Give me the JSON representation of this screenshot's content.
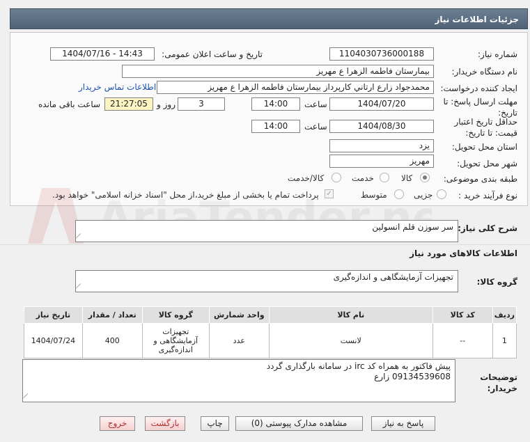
{
  "header": {
    "title": "جزئیات اطلاعات نیاز"
  },
  "fields": {
    "need_number_label": "شماره نیاز:",
    "need_number": "1104030736000188",
    "announce_label": "تاریخ و ساعت اعلان عمومی:",
    "announce_value": "1404/07/16 - 14:43",
    "buyer_org_label": "نام دستگاه خریدار:",
    "buyer_org": "بیمارستان فاطمه الزهرا ع  مهریز",
    "requester_label": "ایجاد کننده درخواست:",
    "requester": "محمدجواد زارع ارتاني كارپرداز بيمارستان فاطمه الزهرا ع  مهريز",
    "contact_link": "اطلاعات تماس خریدار",
    "deadline_label": "مهلت ارسال پاسخ: تا تاریخ:",
    "deadline_date": "1404/07/20",
    "time_label": "ساعت",
    "deadline_time": "14:00",
    "days_value": "3",
    "days_label": "روز و",
    "remaining_time": "21:27:05",
    "remaining_label": "ساعت باقی مانده",
    "validity_label": "حداقل تاریخ اعتبار قیمت: تا تاریخ:",
    "validity_date": "1404/08/30",
    "validity_time": "14:00",
    "province_label": "استان محل تحویل:",
    "province": "یزد",
    "city_label": "شهر محل تحویل:",
    "city": "مهریز",
    "category_label": "طبقه بندی موضوعی:",
    "category_options": [
      "کالا",
      "خدمت",
      "کالا/خدمت"
    ],
    "process_label": "نوع فرآیند خرید :",
    "process_options": [
      "جزیی",
      "متوسط"
    ],
    "payment_note": "پرداخت تمام یا بخشی از مبلغ خرید،از محل \"اسناد خزانه اسلامی\" خواهد بود."
  },
  "summary": {
    "label": "شرح کلی نیاز:",
    "value": "سر سوزن قلم انسولین"
  },
  "goods_info_title": "اطلاعات کالاهای مورد نیاز",
  "goods_group": {
    "label": "گروه کالا:",
    "value": "تجهیزات آزمایشگاهی و اندازه‌گیری"
  },
  "table": {
    "headers": [
      "ردیف",
      "کد کالا",
      "نام کالا",
      "واحد شمارش",
      "گروه کالا",
      "تعداد / مقدار",
      "تاریخ نیاز"
    ],
    "rows": [
      [
        "1",
        "--",
        "لانست",
        "عدد",
        "تجهیزات آزمایشگاهی و اندازه‌گیری",
        "400",
        "1404/07/24"
      ]
    ]
  },
  "notes": {
    "label": "توضیحات خریدار:",
    "line1": "پیش فاکتور به همراه کد irc در سامانه بارگذاری گردد",
    "line2": "09134539608 زارع"
  },
  "buttons": {
    "reply": "پاسخ به نیاز",
    "attachments": "مشاهده مدارک پیوستی (0)",
    "print": "چاپ",
    "back": "بازگشت",
    "exit": "خروج"
  },
  "watermark": "AriaTender.net",
  "colors": {
    "header_bg": "#5b6e82",
    "link": "#1a52b0",
    "remaining_bg": "#fdf4c4"
  }
}
